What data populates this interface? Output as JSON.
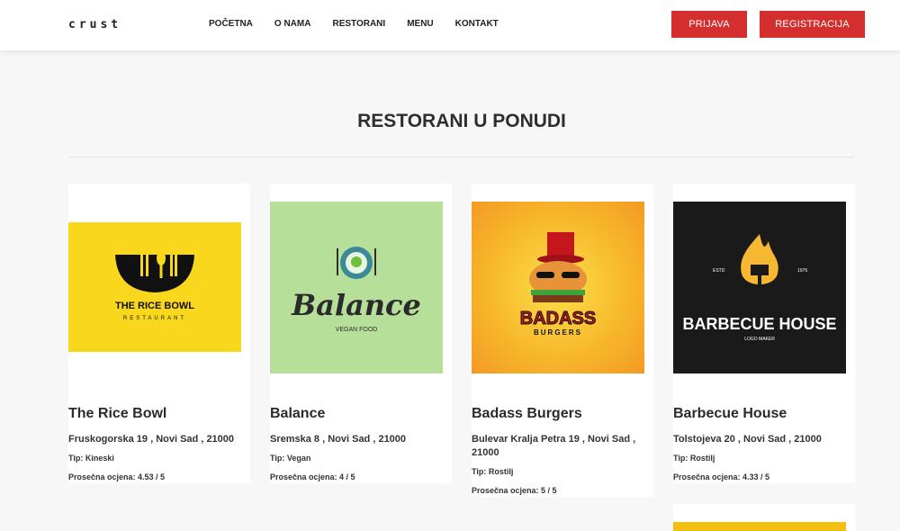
{
  "header": {
    "logo": "crust",
    "nav": [
      "POČETNA",
      "O NAMA",
      "RESTORANI",
      "MENU",
      "KONTAKT"
    ],
    "login_label": "PRIJAVA",
    "register_label": "REGISTRACIJA"
  },
  "page": {
    "title": "RESTORANI U PONUDI"
  },
  "restaurants": [
    {
      "name": "The Rice Bowl",
      "address": "Fruskogorska 19 , Novi Sad , 21000",
      "type": "Tip: Kineski",
      "rating": "Prosečna ocjena: 4.53 / 5",
      "logo_line1": "THE RICE BOWL",
      "logo_line2": "RESTAURANT",
      "bg": "#f9d71c"
    },
    {
      "name": "Balance",
      "address": "Sremska 8 , Novi Sad , 21000",
      "type": "Tip: Vegan",
      "rating": "Prosečna ocjena: 4 / 5",
      "logo_line1": "Balance",
      "logo_line2": "VEGAN FOOD",
      "bg": "#b6df9a"
    },
    {
      "name": "Badass Burgers",
      "address": "Bulevar Kralja Petra 19 , Novi Sad , 21000",
      "type": "Tip: Rostilj",
      "rating": "Prosečna ocjena: 5 / 5",
      "logo_line1": "BADASS",
      "logo_line2": "BURGERS",
      "bg": "#f7c02b"
    },
    {
      "name": "Barbecue House",
      "address": "Tolstojeva 20 , Novi Sad , 21000",
      "type": "Tip: Rostilj",
      "rating": "Prosečna ocjena: 4.33 / 5",
      "logo_line1": "BARBECUE HOUSE",
      "logo_line2": "LOGO MAKER",
      "logo_est": "ESTD",
      "logo_year": "1976",
      "bg": "#1a1a1a"
    }
  ],
  "colors": {
    "accent": "#d32f2f",
    "background": "#f7f7f7"
  }
}
